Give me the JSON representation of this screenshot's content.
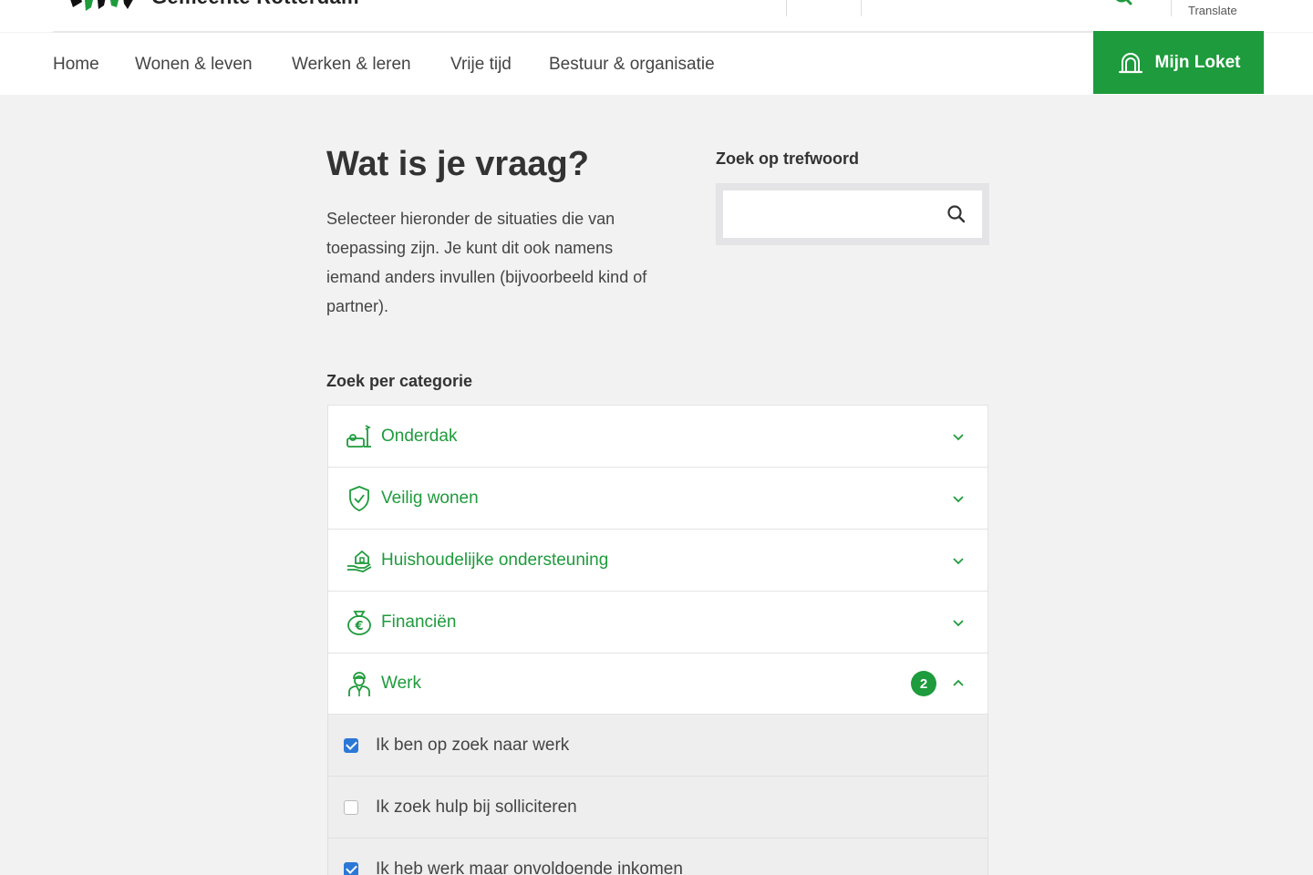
{
  "header": {
    "logo_text": "Gemeente Rotterdam",
    "translate_label": "Translate"
  },
  "nav": {
    "items": [
      "Home",
      "Wonen & leven",
      "Werken & leren",
      "Vrije tijd",
      "Bestuur & organisatie"
    ],
    "mijn_loket": "Mijn Loket"
  },
  "main": {
    "title": "Wat is je vraag?",
    "intro": "Selecteer hieronder de situaties die van toepassing zijn. Je kunt dit ook namens iemand anders invullen (bijvoorbeeld kind of partner).",
    "search_label": "Zoek op trefwoord",
    "search_value": "",
    "category_label": "Zoek per categorie",
    "categories": [
      {
        "label": "Onderdak",
        "icon": "shelter-icon",
        "expanded": false
      },
      {
        "label": "Veilig wonen",
        "icon": "shield-check-icon",
        "expanded": false
      },
      {
        "label": "Huishoudelijke ondersteuning",
        "icon": "hand-house-icon",
        "expanded": false
      },
      {
        "label": "Financiën",
        "icon": "money-bag-icon",
        "expanded": false
      },
      {
        "label": "Werk",
        "icon": "worker-icon",
        "expanded": true,
        "badge": "2"
      }
    ],
    "werk_options": [
      {
        "label": "Ik ben op zoek naar werk",
        "checked": true
      },
      {
        "label": "Ik zoek hulp bij solliciteren",
        "checked": false
      },
      {
        "label": "Ik heb werk maar onvoldoende inkomen",
        "checked": true
      }
    ]
  },
  "colors": {
    "brand_green": "#1e9b3c",
    "checkbox_blue": "#2b78d6",
    "background": "#f2f2f3"
  }
}
